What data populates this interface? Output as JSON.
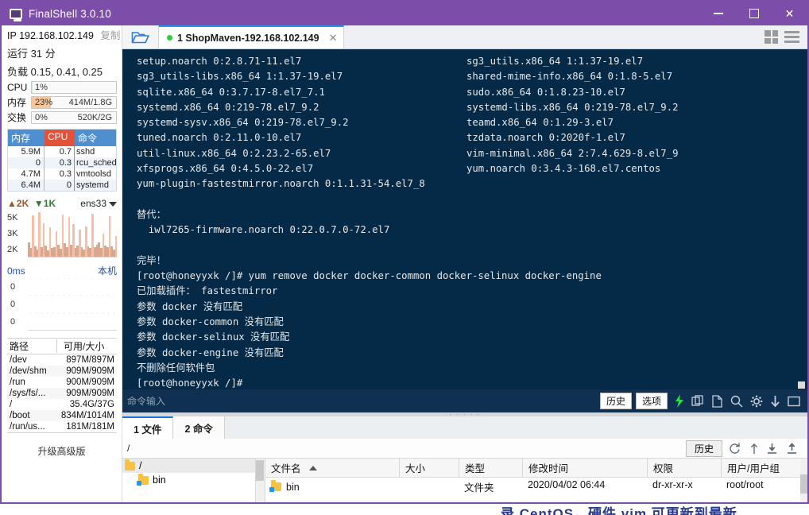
{
  "window": {
    "title": "FinalShell 3.0.10",
    "app_icon": "monitor-icon",
    "minimize": "–",
    "maximize": "□",
    "close": "✕"
  },
  "sidebar": {
    "ip_label": "IP",
    "ip_value": "192.168.102.149",
    "copy_label": "复制",
    "uptime_label": "运行",
    "uptime_value": "31 分",
    "load_label": "负载",
    "load_value": "0.15, 0.41, 0.25",
    "meters": [
      {
        "label": "CPU",
        "pct": "1%",
        "pct_num": 1,
        "extra": "",
        "color": "#cfe8cf"
      },
      {
        "label": "内存",
        "pct": "23%",
        "pct_num": 23,
        "extra": "414M/1.8G",
        "color": "#f6c79a"
      },
      {
        "label": "交换",
        "pct": "0%",
        "pct_num": 0,
        "extra": "520K/2G",
        "color": "#f6c79a"
      }
    ],
    "process_table": {
      "headers": [
        "内存",
        "CPU",
        "命令"
      ],
      "rows": [
        {
          "mem": "5.9M",
          "cpu": "0.7",
          "cmd": "sshd"
        },
        {
          "mem": "0",
          "cpu": "0.3",
          "cmd": "rcu_sched"
        },
        {
          "mem": "4.7M",
          "cpu": "0.3",
          "cmd": "vmtoolsd"
        },
        {
          "mem": "6.4M",
          "cpu": "0",
          "cmd": "systemd"
        }
      ]
    },
    "network": {
      "up_label": "2K",
      "down_label": "1K",
      "interface": "ens33",
      "axis": [
        "5K",
        "3K",
        "2K"
      ]
    },
    "latency": {
      "value_label": "0ms",
      "host_label": "本机",
      "axis": [
        "0",
        "0",
        "0"
      ]
    },
    "disk_table": {
      "headers": [
        "路径",
        "可用/大小"
      ],
      "rows": [
        {
          "path": "/dev",
          "size": "897M/897M"
        },
        {
          "path": "/dev/shm",
          "size": "909M/909M"
        },
        {
          "path": "/run",
          "size": "900M/909M"
        },
        {
          "path": "/sys/fs/...",
          "size": "909M/909M"
        },
        {
          "path": "/",
          "size": "35.4G/37G"
        },
        {
          "path": "/boot",
          "size": "834M/1014M"
        },
        {
          "path": "/run/us...",
          "size": "181M/181M"
        }
      ]
    },
    "upgrade_label": "升级高级版"
  },
  "tabbar": {
    "folder_icon": "open-folder-icon",
    "tab_label": "1 ShopMaven-192.168.102.149",
    "close_label": "✕",
    "grid_icon": "grid-view-icon",
    "menu_icon": "hamburger-menu-icon"
  },
  "terminal": {
    "left_lines": [
      "setup.noarch 0:2.8.71-11.el7",
      "sg3_utils-libs.x86_64 1:1.37-19.el7",
      "sqlite.x86_64 0:3.7.17-8.el7_7.1",
      "systemd.x86_64 0:219-78.el7_9.2",
      "systemd-sysv.x86_64 0:219-78.el7_9.2",
      "tuned.noarch 0:2.11.0-10.el7",
      "util-linux.x86_64 0:2.23.2-65.el7",
      "xfsprogs.x86_64 0:4.5.0-22.el7",
      "yum-plugin-fastestmirror.noarch 0:1.1.31-54.el7_8"
    ],
    "right_lines": [
      "sg3_utils.x86_64 1:1.37-19.el7",
      "shared-mime-info.x86_64 0:1.8-5.el7",
      "sudo.x86_64 0:1.8.23-10.el7",
      "systemd-libs.x86_64 0:219-78.el7_9.2",
      "teamd.x86_64 0:1.29-3.el7",
      "tzdata.noarch 0:2020f-1.el7",
      "vim-minimal.x86_64 2:7.4.629-8.el7_9",
      "yum.noarch 0:3.4.3-168.el7.centos"
    ],
    "body_lines": [
      "",
      "替代：",
      "  iwl7265-firmware.noarch 0:22.0.7.0-72.el7",
      "",
      "完毕！",
      "[root@honeyyxk /]# yum remove docker docker-common docker-selinux docker-engine",
      "已加载插件： fastestmirror",
      "参数 docker 没有匹配",
      "参数 docker-common 没有匹配",
      "参数 docker-selinux 没有匹配",
      "参数 docker-engine 没有匹配",
      "不删除任何软件包",
      "[root@honeyyxk /]#"
    ]
  },
  "command_bar": {
    "placeholder": "命令输入",
    "value": "",
    "history_label": "历史",
    "options_label": "选项",
    "icons": [
      "lightning-icon",
      "paste-icon",
      "copy-icon",
      "search-icon",
      "gear-icon",
      "download-icon",
      "window-icon"
    ]
  },
  "bottom": {
    "tabs": [
      {
        "label": "1 文件",
        "active": true
      },
      {
        "label": "2 命令",
        "active": false
      }
    ],
    "path_value": "/",
    "path_history_label": "历史",
    "path_icons": [
      "refresh-icon",
      "up-arrow-icon",
      "download-icon",
      "upload-icon"
    ],
    "tree": [
      {
        "label": "/",
        "depth": 0,
        "selected": true
      },
      {
        "label": "bin",
        "depth": 1,
        "selected": false
      }
    ],
    "file_headers": [
      "文件名",
      "大小",
      "类型",
      "修改时间",
      "权限",
      "用户/用户组"
    ],
    "file_rows": [
      {
        "name": "bin",
        "size": "",
        "type": "文件夹",
        "time": "2020/04/02 06:44",
        "perm": "dr-xr-xr-x",
        "user": "root/root"
      }
    ]
  },
  "background": {
    "bottom_text": "录 CentOS，硬件 vim 可更新到最新"
  },
  "colors": {
    "titlebar": "#7c4ea9",
    "terminal_bg": "#042a47",
    "accent_blue": "#2196f3",
    "proc_header_blue": "#4f8fd0",
    "proc_header_red": "#e2523b",
    "cmdbar_bg": "#0f3050",
    "status_dot_green": "#2ecc40"
  }
}
